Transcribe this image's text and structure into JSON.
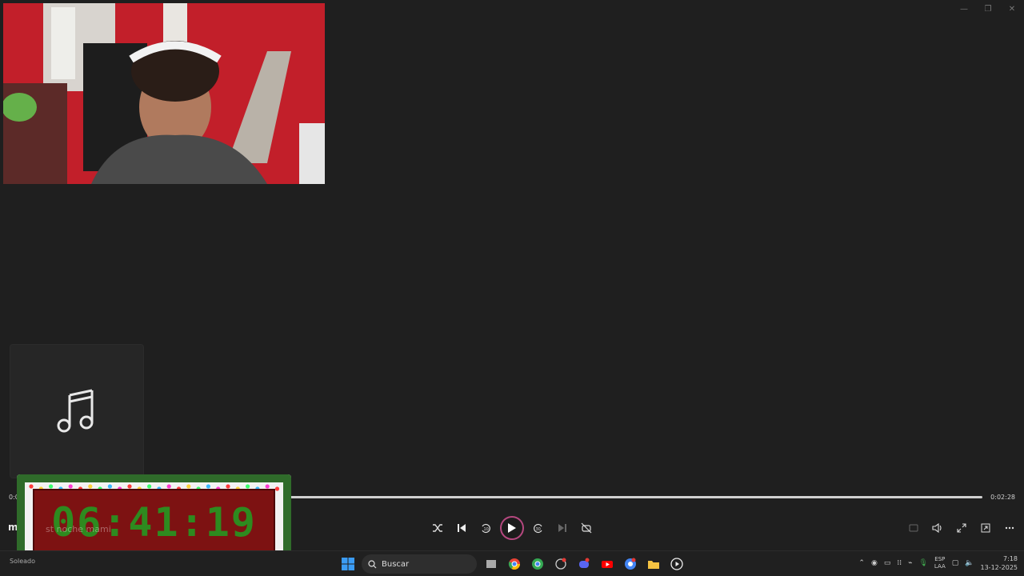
{
  "window": {
    "minimize": "—",
    "restore": "❐",
    "close": "✕"
  },
  "player": {
    "elapsed": "0:0",
    "duration": "0:02:28",
    "progress_fraction": 0.02,
    "track_title": "m",
    "track_subtitle": "st noche mami",
    "album_icon": "music-note-icon"
  },
  "countdown": {
    "time": "06:41:19"
  },
  "taskbar": {
    "weather": "Soleado",
    "search_placeholder": "Buscar",
    "language_top": "ESP",
    "language_bottom": "LAA",
    "time": "7:18",
    "date": "13-12-2025"
  },
  "colors": {
    "accent": "#b5487f",
    "background": "#1f1f1f",
    "countdown_digits": "#2e8a1f"
  }
}
